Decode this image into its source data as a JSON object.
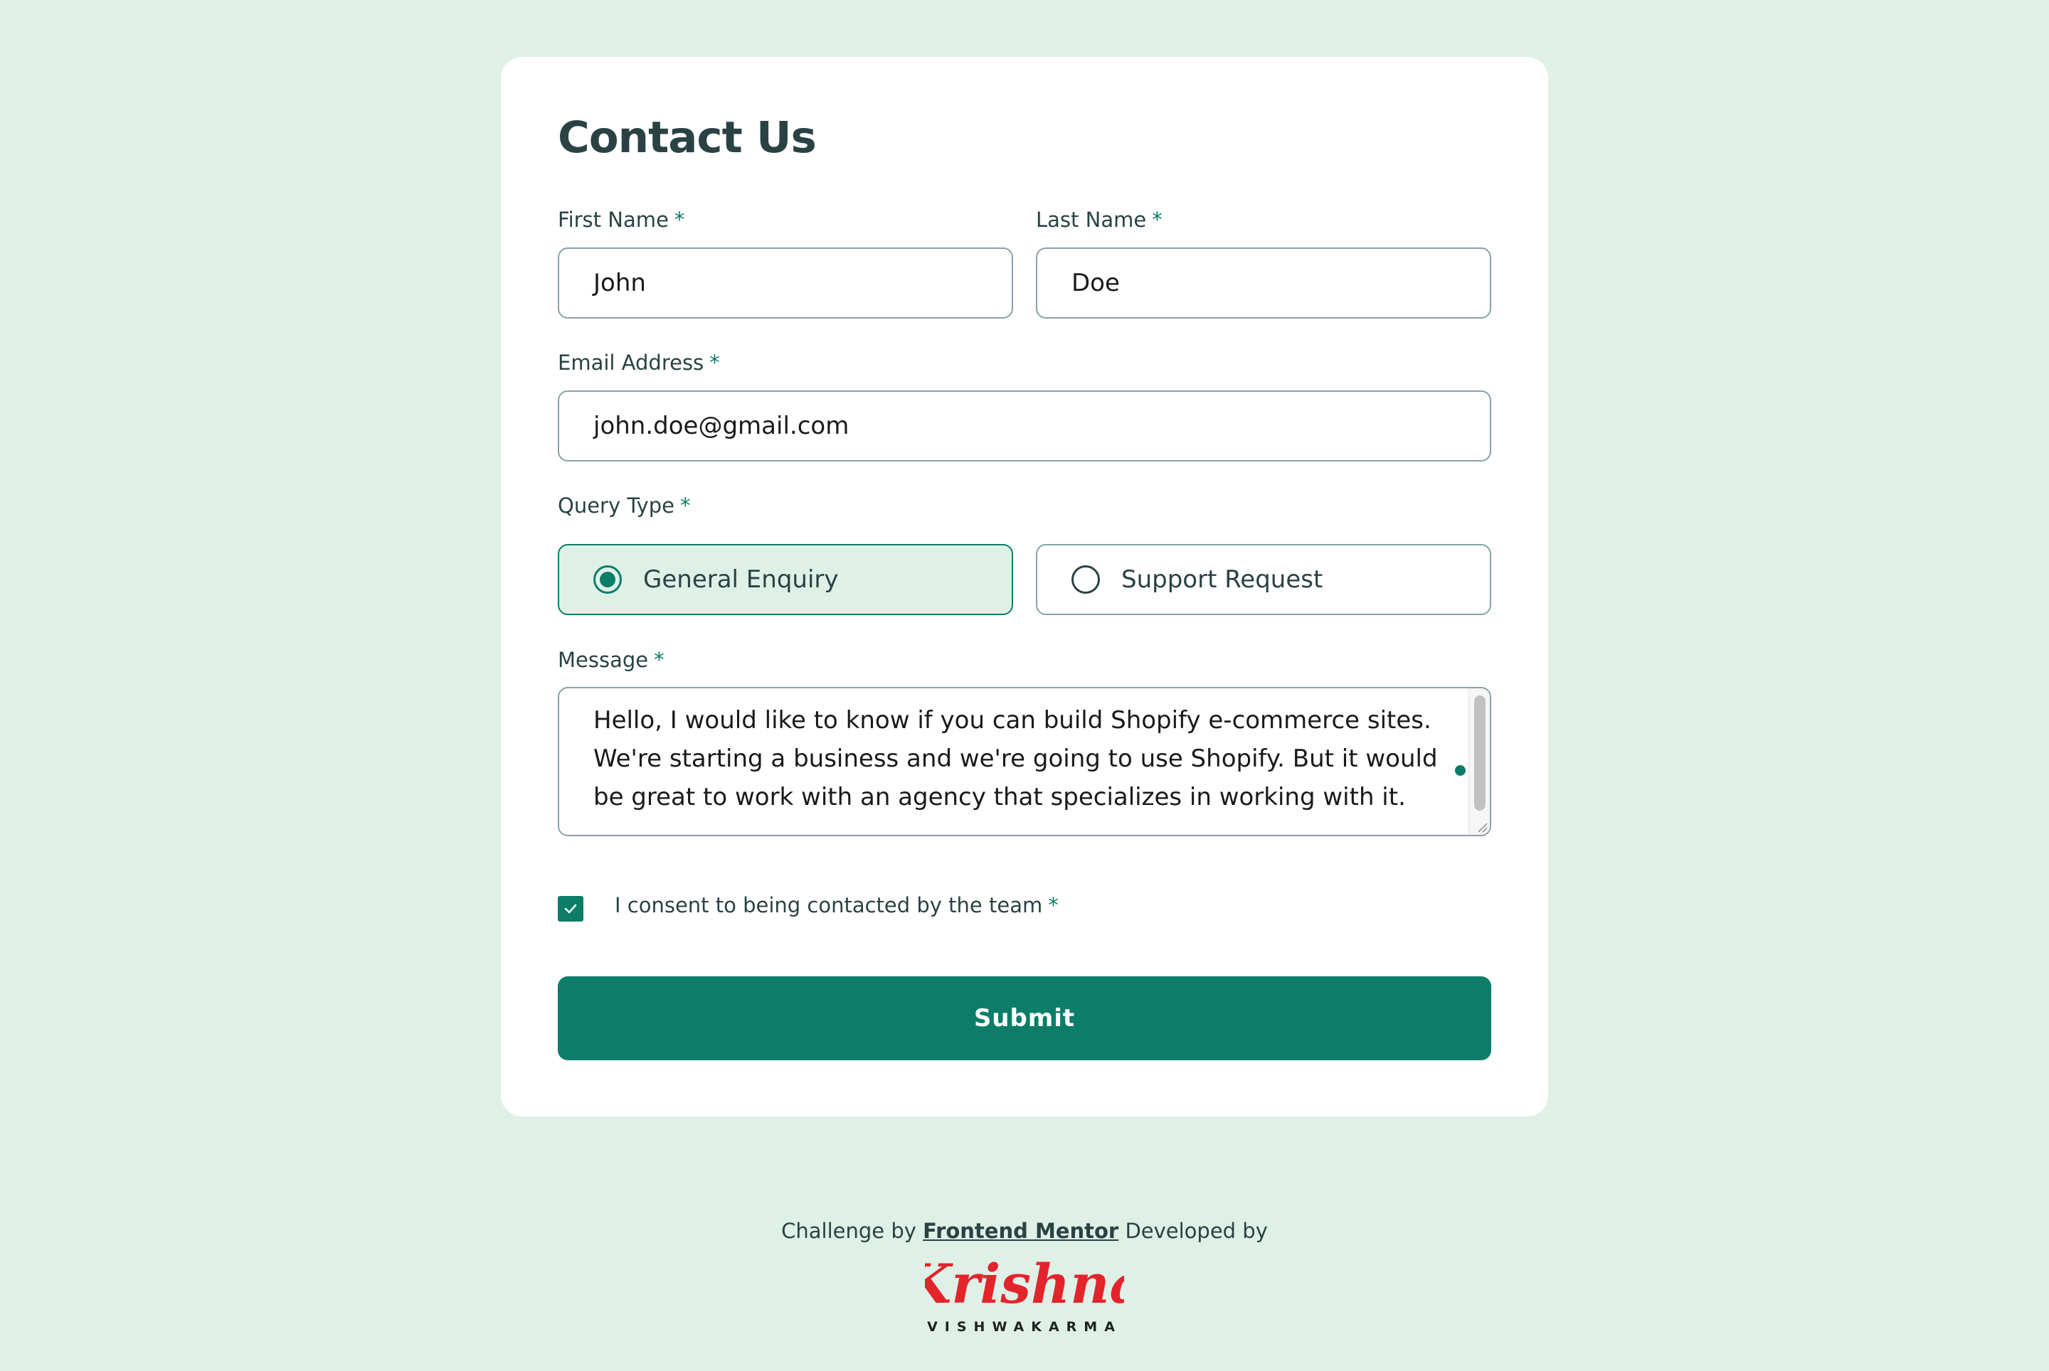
{
  "form": {
    "title": "Contact Us",
    "first_name": {
      "label": "First Name",
      "required": "*",
      "value": "John"
    },
    "last_name": {
      "label": "Last Name",
      "required": "*",
      "value": "Doe"
    },
    "email": {
      "label": "Email Address",
      "required": "*",
      "value": "john.doe@gmail.com"
    },
    "query_type": {
      "label": "Query Type",
      "required": "*",
      "options": [
        {
          "label": "General Enquiry",
          "selected": true
        },
        {
          "label": "Support Request",
          "selected": false
        }
      ]
    },
    "message": {
      "label": "Message",
      "required": "*",
      "value": "Hello, I would like to know if you can build Shopify e-commerce sites. We're starting a business and we're going to use Shopify. But it would be great to work with an agency that specializes in working with it."
    },
    "consent": {
      "label": "I consent to being contacted by the team",
      "required": "*",
      "checked": true
    },
    "submit_label": "Submit"
  },
  "footer": {
    "challenge_by": "Challenge by",
    "link_text": "Frontend Mentor",
    "developed_by": "Developed by",
    "logo_name": "Krishna",
    "logo_subtitle": "VISHWAKARMA"
  },
  "colors": {
    "background": "#dff1e7",
    "accent": "#0c7d69",
    "text": "#2a4244",
    "logo_red": "#e3242b"
  }
}
